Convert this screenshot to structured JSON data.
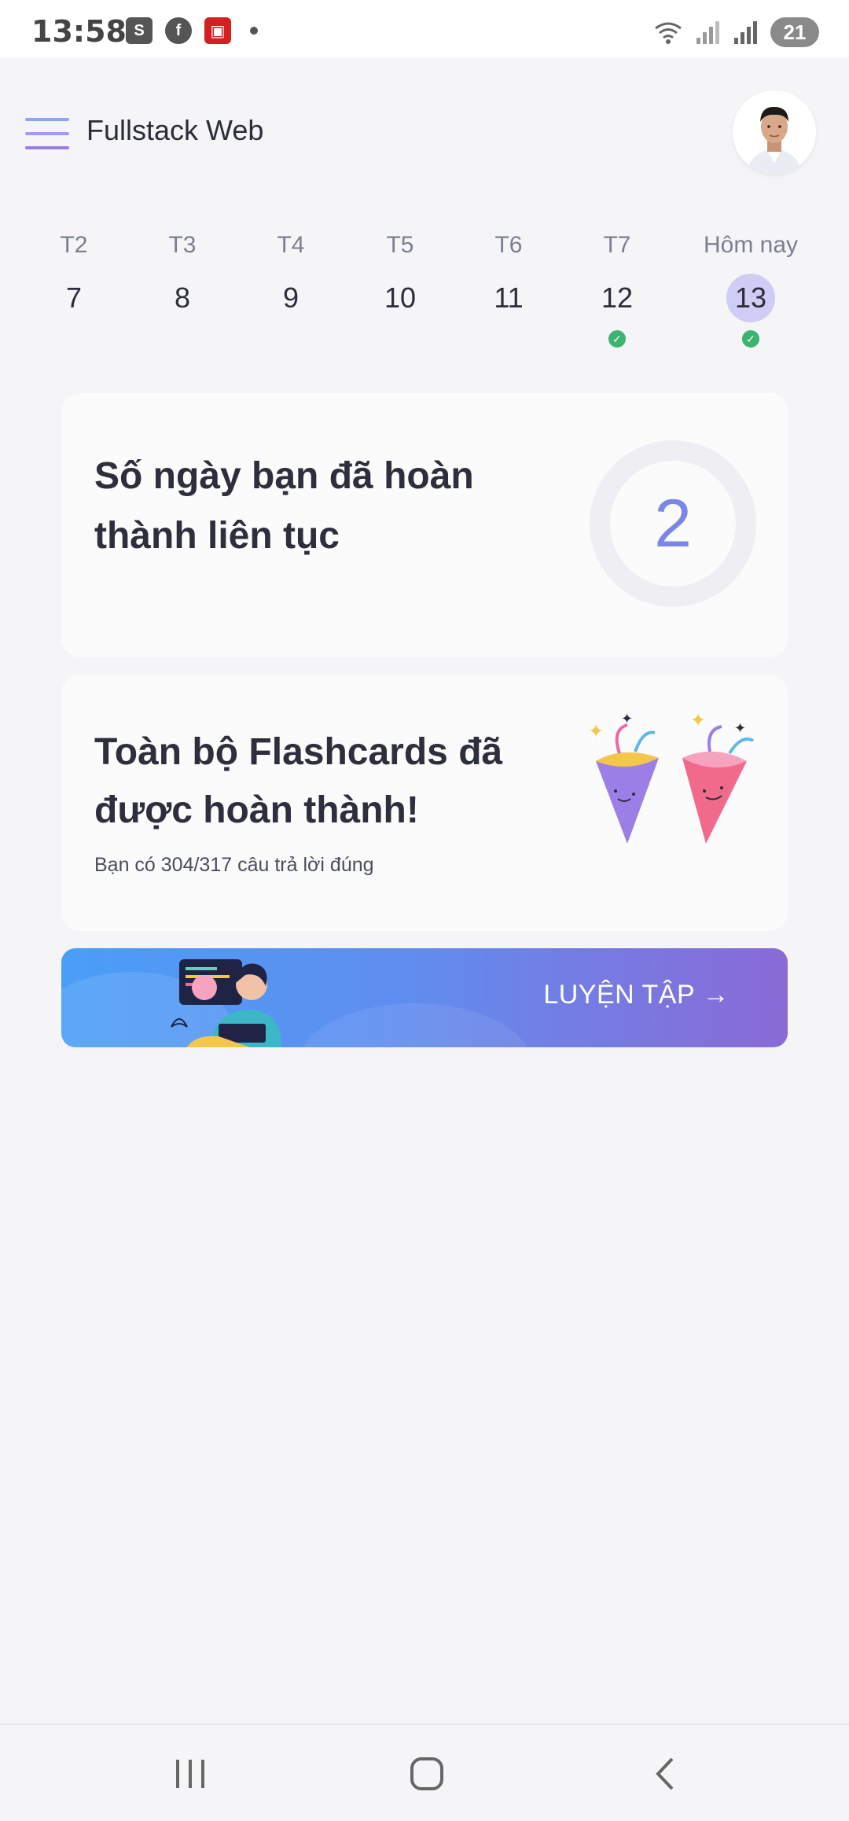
{
  "status_bar": {
    "time": "13:58",
    "battery": "21",
    "left_icons": [
      "shopee-icon",
      "facebook-icon",
      "app-icon",
      "dot"
    ],
    "right_icons": [
      "wifi-icon",
      "signal-icon",
      "signal-icon",
      "battery-icon"
    ]
  },
  "header": {
    "title": "Fullstack Web",
    "menu_icon": "hamburger-menu-icon",
    "avatar_icon": "user-avatar"
  },
  "week": {
    "days": [
      {
        "label": "T2",
        "num": "7",
        "done": false,
        "today": false
      },
      {
        "label": "T3",
        "num": "8",
        "done": false,
        "today": false
      },
      {
        "label": "T4",
        "num": "9",
        "done": false,
        "today": false
      },
      {
        "label": "T5",
        "num": "10",
        "done": false,
        "today": false
      },
      {
        "label": "T6",
        "num": "11",
        "done": false,
        "today": false
      },
      {
        "label": "T7",
        "num": "12",
        "done": true,
        "today": false
      },
      {
        "label": "Hôm nay",
        "num": "13",
        "done": true,
        "today": true
      }
    ]
  },
  "streak_card": {
    "title": "Số ngày bạn đã hoàn thành liên tục",
    "value": "2"
  },
  "done_card": {
    "title": "Toàn bộ Flashcards đã được hoàn thành!",
    "subtitle": "Bạn có 304/317 câu trả lời đúng"
  },
  "cta": {
    "label": "LUYỆN TẬP →"
  },
  "colors": {
    "accent": "#7b86e6",
    "today_bg": "#cfccf5",
    "check": "#3cb371",
    "cta_start": "#4a9ef6",
    "cta_end": "#8a6ad6"
  }
}
